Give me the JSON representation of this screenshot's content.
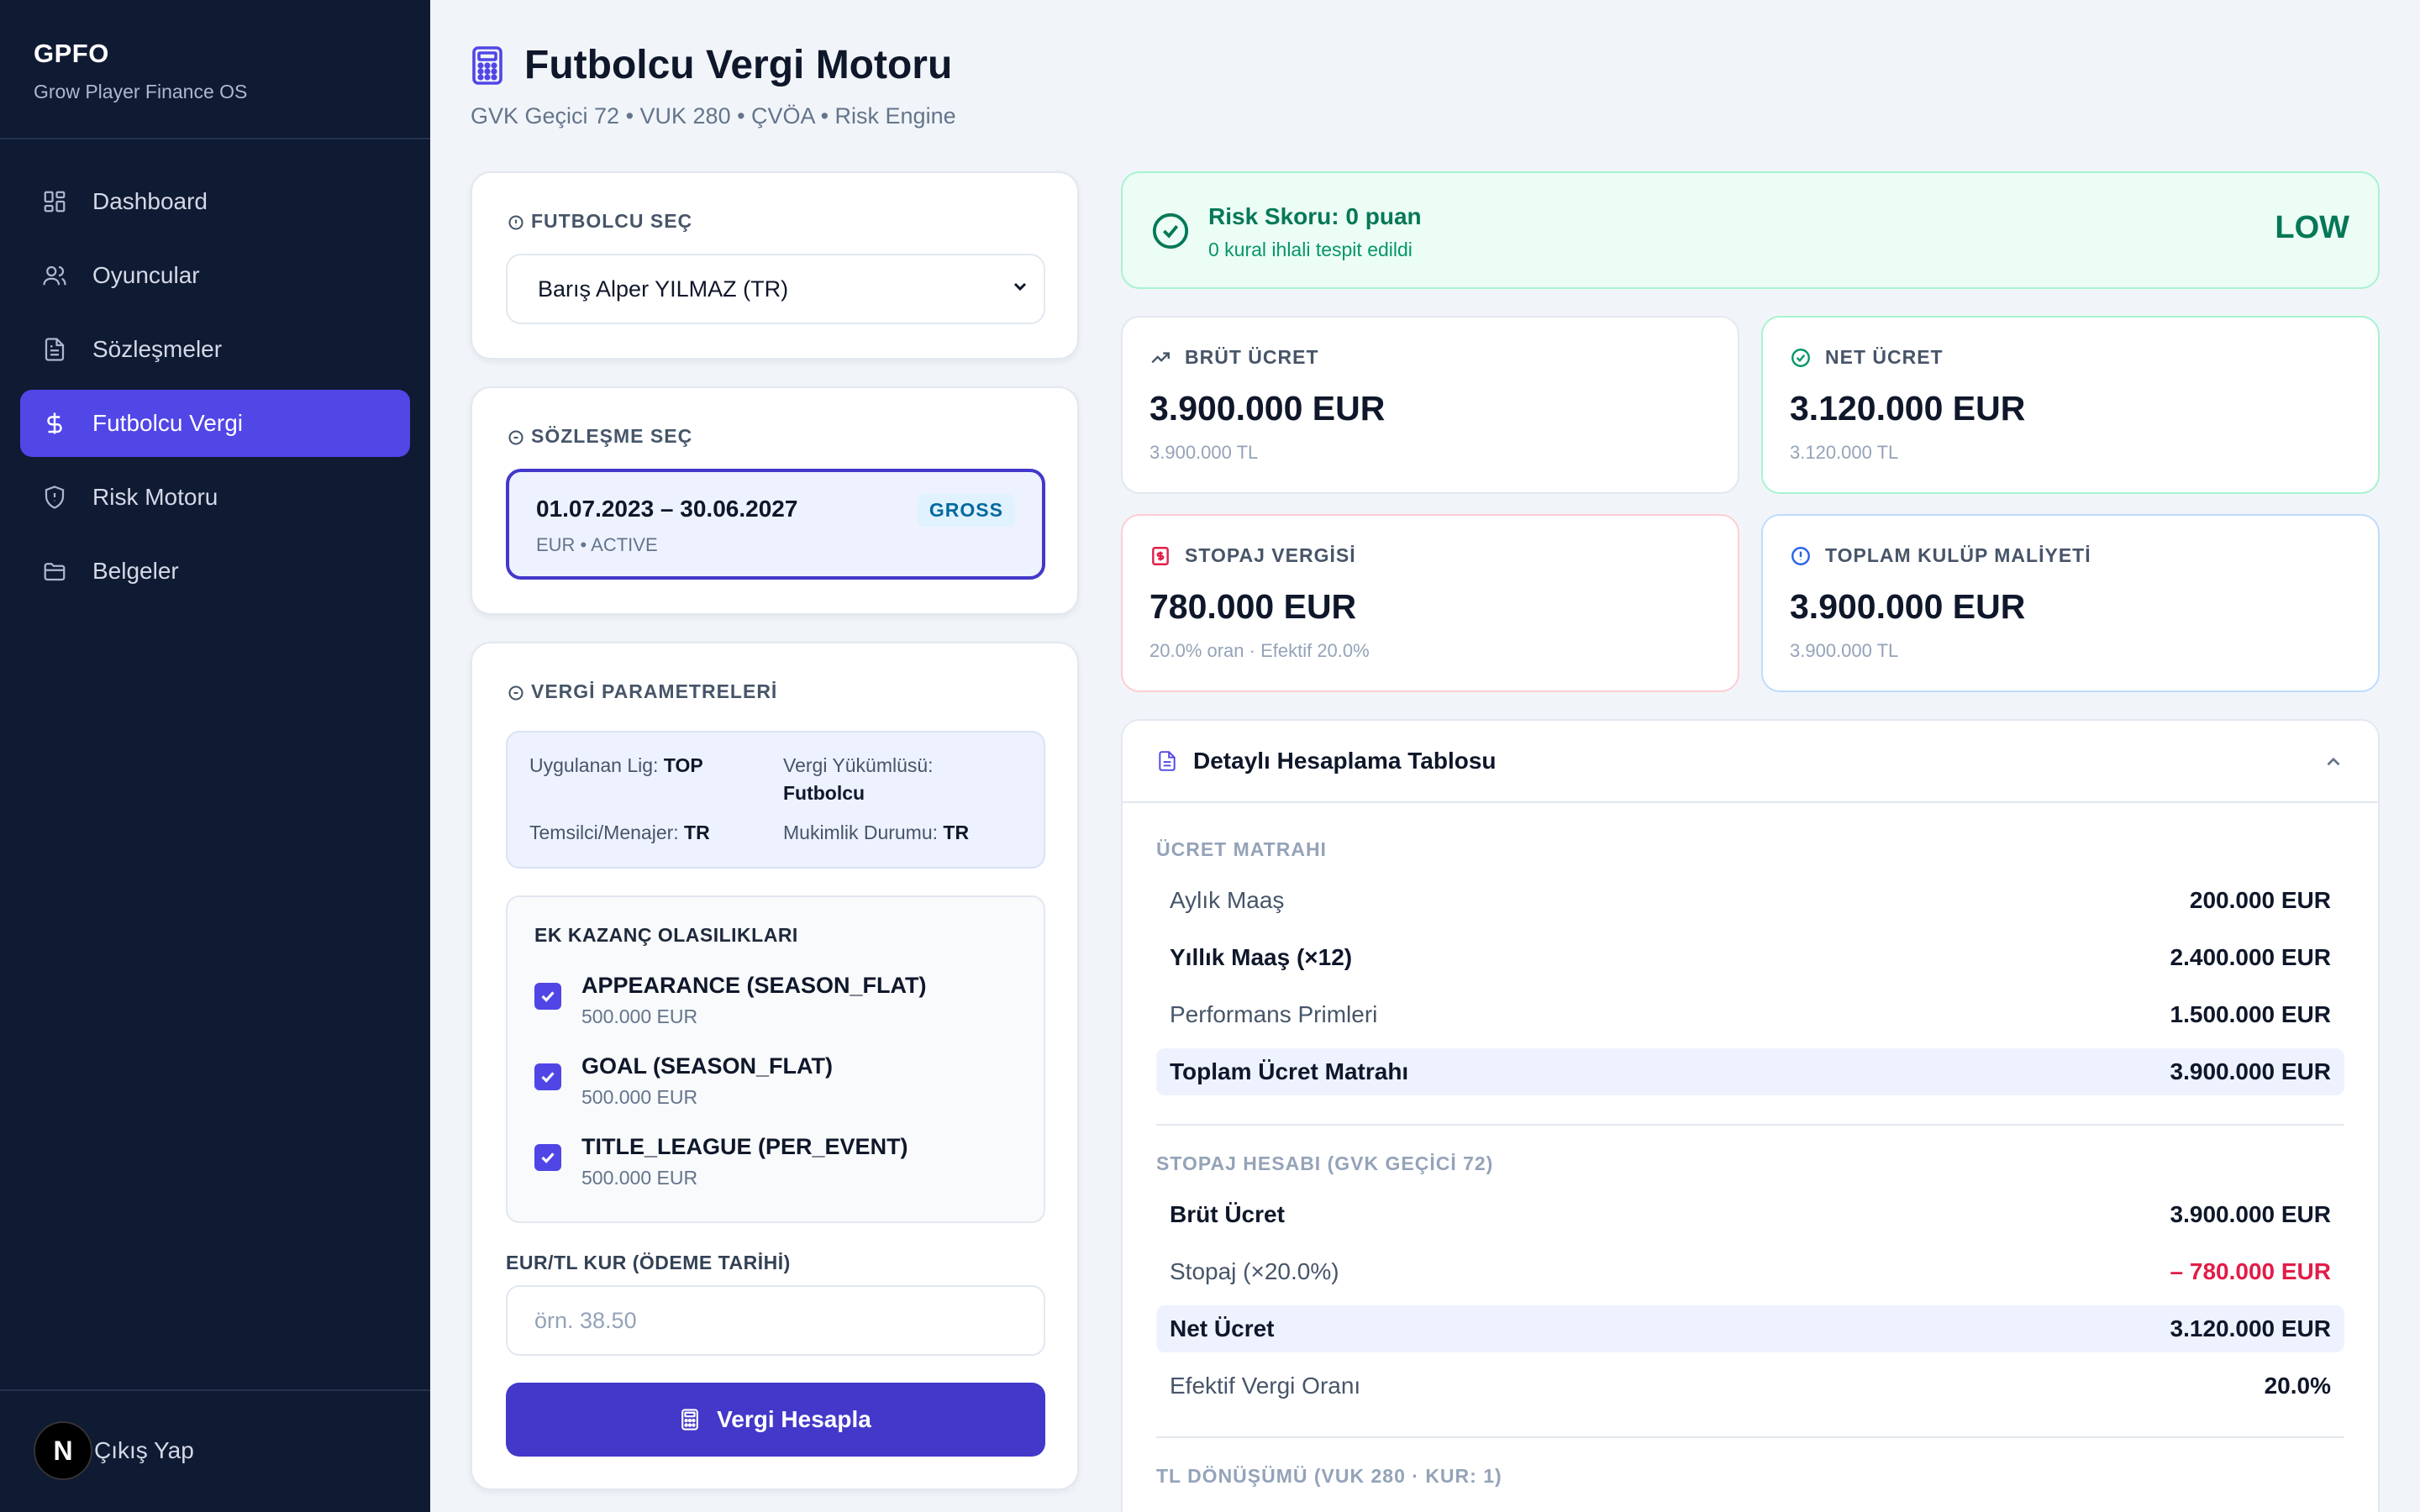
{
  "sidebar": {
    "brand_title": "GPFO",
    "brand_sub": "Grow Player Finance OS",
    "items": [
      {
        "label": "Dashboard",
        "icon": "dashboard-icon"
      },
      {
        "label": "Oyuncular",
        "icon": "users-icon"
      },
      {
        "label": "Sözleşmeler",
        "icon": "document-icon"
      },
      {
        "label": "Futbolcu Vergi",
        "icon": "dollar-icon",
        "active": true
      },
      {
        "label": "Risk Motoru",
        "icon": "shield-icon"
      },
      {
        "label": "Belgeler",
        "icon": "folder-icon"
      }
    ],
    "logout_label": "Çıkış Yap",
    "badge_letter": "N"
  },
  "header": {
    "title": "Futbolcu Vergi Motoru",
    "subtitle": "GVK Geçici 72 • VUK 280 • ÇVÖA • Risk Engine"
  },
  "player_select": {
    "label": "FUTBOLCU SEÇ",
    "value": "Barış Alper YILMAZ (TR)"
  },
  "contract_select": {
    "label": "SÖZLEŞME SEÇ",
    "dates": "01.07.2023 – 30.06.2027",
    "meta": "EUR • ACTIVE",
    "badge": "GROSS"
  },
  "tax_params": {
    "label": "VERGİ PARAMETRELERİ",
    "league_label": "Uygulanan Lig:",
    "league_value": "TOP",
    "obligor_label": "Vergi Yükümlüsü:",
    "obligor_value": "Futbolcu",
    "agent_label": "Temsilci/Menajer:",
    "agent_value": "TR",
    "residency_label": "Mukimlik Durumu:",
    "residency_value": "TR"
  },
  "extra_earnings": {
    "title": "EK KAZANÇ OLASILIKLARI",
    "items": [
      {
        "name": "APPEARANCE (SEASON_FLAT)",
        "amount": "500.000 EUR",
        "checked": true
      },
      {
        "name": "GOAL (SEASON_FLAT)",
        "amount": "500.000 EUR",
        "checked": true
      },
      {
        "name": "TITLE_LEAGUE (PER_EVENT)",
        "amount": "500.000 EUR",
        "checked": true
      }
    ]
  },
  "fx": {
    "label": "EUR/TL KUR (ÖDEME TARİHİ)",
    "placeholder": "örn. 38.50"
  },
  "calc_button": "Vergi Hesapla",
  "risk": {
    "title": "Risk Skoru: 0 puan",
    "sub": "0 kural ihlali tespit edildi",
    "level": "LOW"
  },
  "kpis": {
    "gross": {
      "label": "BRÜT ÜCRET",
      "value": "3.900.000 EUR",
      "sub": "3.900.000 TL",
      "accent": "#e2e8f0"
    },
    "net": {
      "label": "NET ÜCRET",
      "value": "3.120.000 EUR",
      "sub": "3.120.000 TL",
      "accent": "#a7f3d0"
    },
    "withholding": {
      "label": "STOPAJ VERGİSİ",
      "value": "780.000 EUR",
      "sub": "20.0% oran · Efektif 20.0%",
      "accent": "#fecdd3"
    },
    "club_cost": {
      "label": "TOPLAM KULÜP MALİYETİ",
      "value": "3.900.000 EUR",
      "sub": "3.900.000 TL",
      "accent": "#bfdbfe"
    }
  },
  "detail": {
    "title": "Detaylı Hesaplama Tablosu",
    "group1_label": "ÜCRET MATRAHI",
    "group1": [
      {
        "label": "Aylık Maaş",
        "value": "200.000 EUR"
      },
      {
        "label": "Yıllık Maaş (×12)",
        "value": "2.400.000 EUR"
      },
      {
        "label": "Performans Primleri",
        "value": "1.500.000 EUR"
      },
      {
        "label": "Toplam Ücret Matrahı",
        "value": "3.900.000 EUR"
      }
    ],
    "group2_label": "STOPAJ HESABI (GVK GEÇİCİ 72)",
    "group2": [
      {
        "label": "Brüt Ücret",
        "value": "3.900.000 EUR"
      },
      {
        "label": "Stopaj (×20.0%)",
        "value": "– 780.000 EUR"
      },
      {
        "label": "Net Ücret",
        "value": "3.120.000 EUR"
      },
      {
        "label": "Efektif Vergi Oranı",
        "value": "20.0%"
      }
    ],
    "group3_label": "TL DÖNÜŞÜMÜ (VUK 280 · KUR: 1)"
  },
  "colors": {
    "sidebar_bg": "#0f1a33",
    "active_nav": "#5146e6",
    "primary": "#4338ca",
    "success": "#047857",
    "danger": "#e11d48"
  }
}
